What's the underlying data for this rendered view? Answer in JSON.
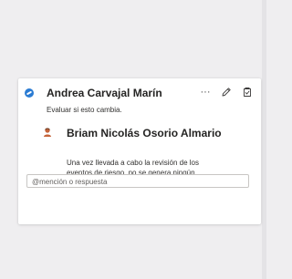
{
  "comment": {
    "author": "Andrea Carvajal Marín",
    "text": "Evaluar si esto cambia."
  },
  "reply": {
    "author": "Briam Nicolás Osorio Almario",
    "text": "Una vez llevada a cabo la revisión de los eventos de riesgo, no se genera ningún cambio en el presente apartado."
  },
  "actions": {
    "more_label": "···"
  },
  "reply_box": {
    "placeholder": "@mención o respuesta"
  },
  "icons": {
    "author_avatar": "person-circle-icon",
    "reply_avatar": "person-icon",
    "edit": "pencil-icon",
    "resolve": "resolve-icon"
  },
  "colors": {
    "accent": "#2b7cd3",
    "reply_avatar": "#c5643a",
    "background": "#efeef0"
  }
}
